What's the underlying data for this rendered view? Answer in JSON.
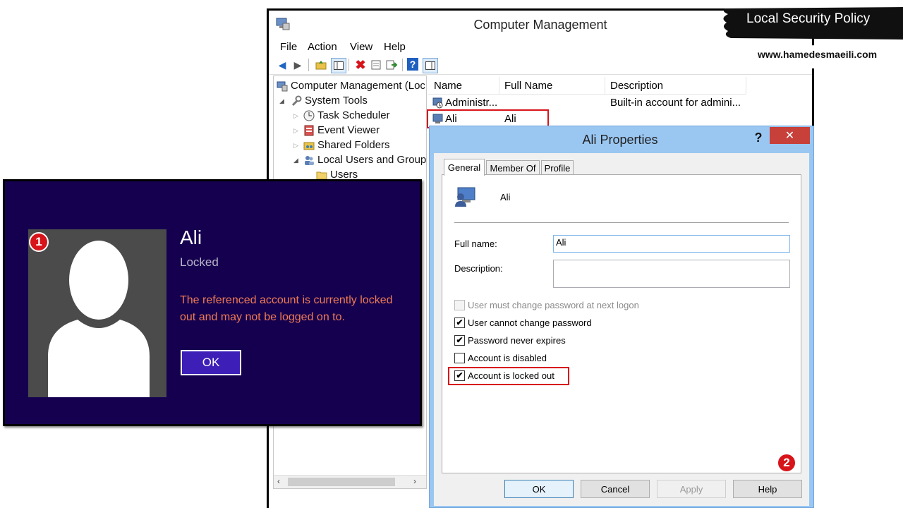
{
  "brand": {
    "banner": "Local Security Policy",
    "url": "www.hamedesmaeili.com"
  },
  "computer_management": {
    "title": "Computer Management",
    "menu": [
      "File",
      "Action",
      "View",
      "Help"
    ],
    "tree": {
      "root": "Computer Management (Loc",
      "system_tools": "System Tools",
      "task_scheduler": "Task Scheduler",
      "event_viewer": "Event Viewer",
      "shared_folders": "Shared Folders",
      "local_users": "Local Users and Group",
      "users": "Users"
    },
    "list": {
      "columns": [
        "Name",
        "Full Name",
        "Description"
      ],
      "rows": [
        {
          "name": "Administr...",
          "full_name": "",
          "description": "Built-in account for admini..."
        },
        {
          "name": "Ali",
          "full_name": "Ali",
          "description": ""
        }
      ]
    }
  },
  "lock_screen": {
    "badge": "1",
    "user_name": "Ali",
    "status": "Locked",
    "message": "The referenced account is currently locked out and may not be logged on to.",
    "ok_label": "OK"
  },
  "properties_dialog": {
    "title": "Ali Properties",
    "help_glyph": "?",
    "close_glyph": "✕",
    "badge": "2",
    "tabs": [
      "General",
      "Member Of",
      "Profile"
    ],
    "active_tab": "General",
    "account_name": "Ali",
    "full_name_label": "Full name:",
    "full_name_value": "Ali",
    "description_label": "Description:",
    "description_value": "",
    "checkboxes": [
      {
        "label": "User must change password at next logon",
        "checked": false,
        "enabled": false
      },
      {
        "label": "User cannot change password",
        "checked": true,
        "enabled": true
      },
      {
        "label": "Password never expires",
        "checked": true,
        "enabled": true
      },
      {
        "label": "Account is disabled",
        "checked": false,
        "enabled": true
      },
      {
        "label": "Account is locked out",
        "checked": true,
        "enabled": true
      }
    ],
    "buttons": {
      "ok": "OK",
      "cancel": "Cancel",
      "apply": "Apply",
      "help": "Help"
    }
  }
}
